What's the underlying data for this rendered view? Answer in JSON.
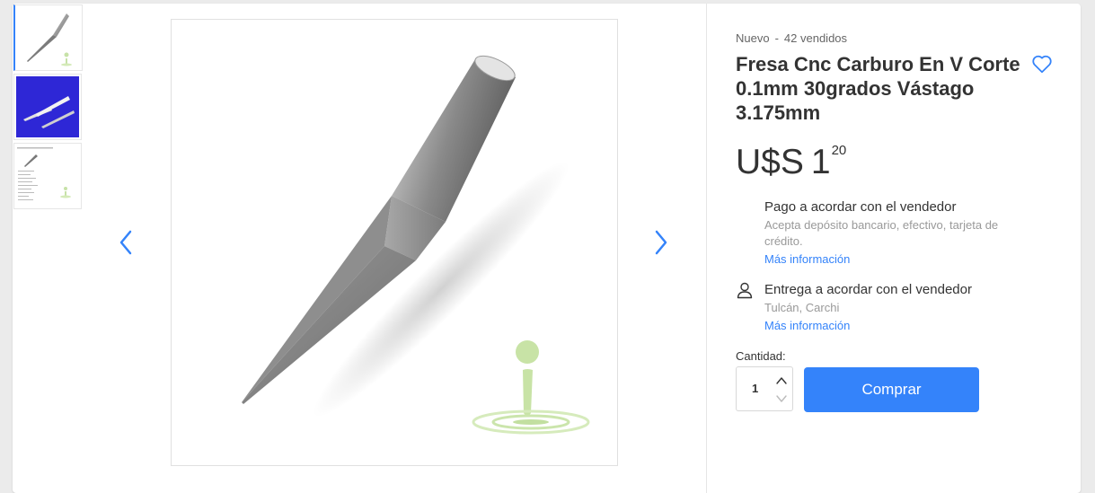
{
  "product": {
    "condition": "Nuevo",
    "separator": "-",
    "sold": "42 vendidos",
    "title": "Fresa Cnc Carburo En V Corte 0.1mm 30grados Vástago 3.175mm",
    "favorite_icon": "heart-outline-icon"
  },
  "price": {
    "currency": "U$S",
    "amount": "1",
    "cents": "20"
  },
  "payment": {
    "title": "Pago a acordar con el vendedor",
    "description": "Acepta depósito bancario, efectivo, tarjeta de crédito.",
    "link": "Más información"
  },
  "shipping": {
    "icon": "person-icon",
    "title": "Entrega a acordar con el vendedor",
    "location": "Tulcán, Carchi",
    "link": "Más información"
  },
  "quantity": {
    "label": "Cantidad:",
    "value": "1"
  },
  "buy_button": "Comprar",
  "gallery": {
    "thumbnails": [
      "engraving-bit-photo",
      "bits-on-blue-background-photo",
      "spec-sheet-photo"
    ],
    "selected_index": 0
  },
  "colors": {
    "accent": "#3483fa",
    "background": "#ebebeb"
  }
}
